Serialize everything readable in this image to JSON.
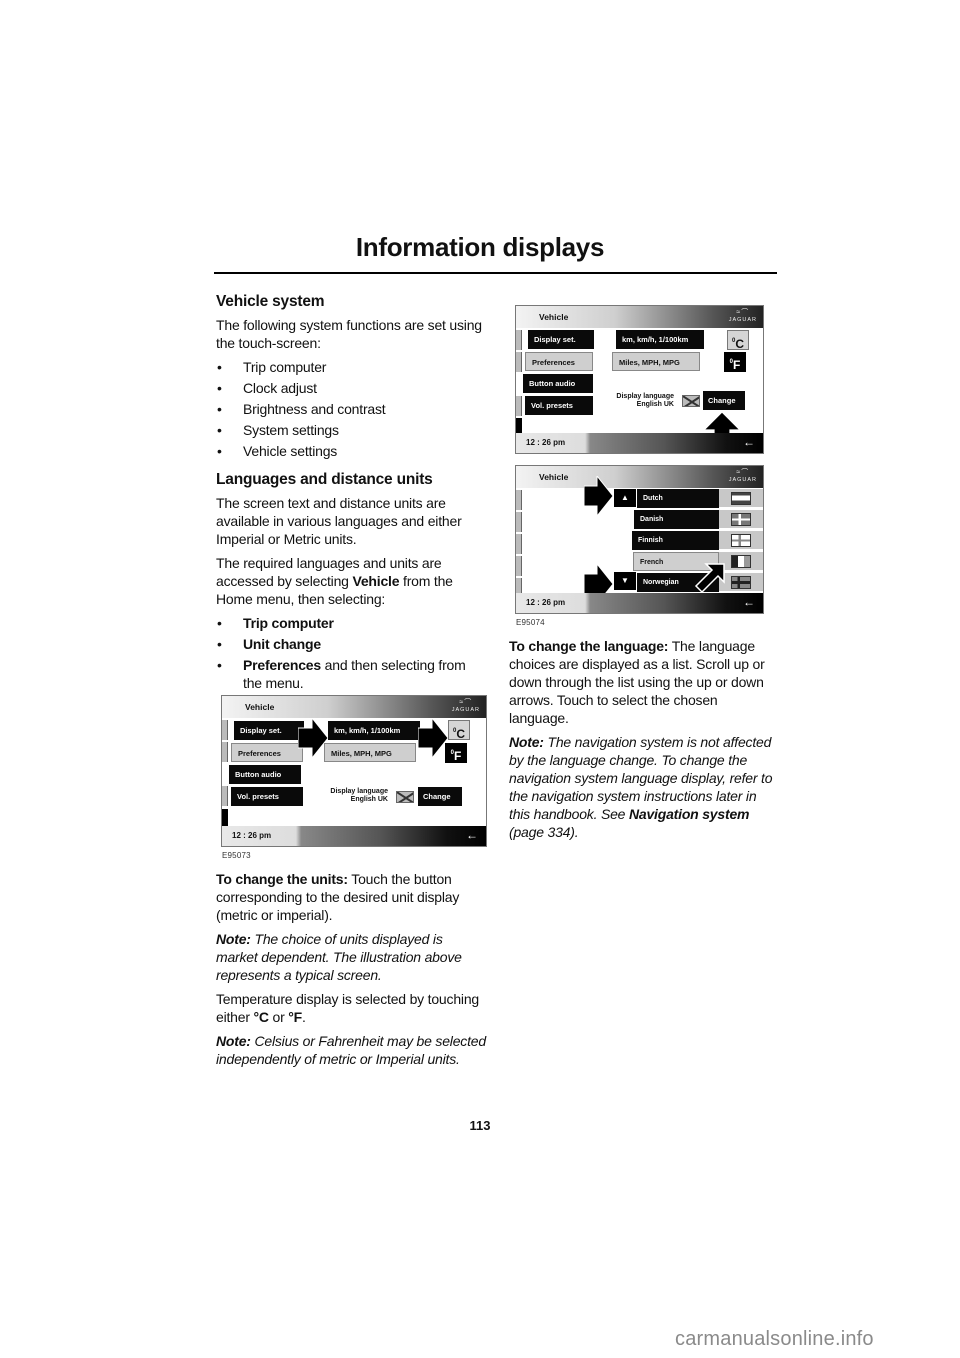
{
  "page": {
    "title": "Information displays",
    "page_number": "113",
    "watermark": "carmanualsonline.info"
  },
  "left": {
    "section1": {
      "heading": "Vehicle system",
      "intro": "The following system functions are set using the touch-screen:",
      "items": [
        "Trip computer",
        "Clock adjust",
        "Brightness and contrast",
        "System settings",
        "Vehicle settings"
      ]
    },
    "section2": {
      "heading": "Languages and distance units",
      "p1": "The screen text and distance units are available in various languages and either Imperial or Metric units.",
      "p2_pre": "The required languages and units are accessed by selecting ",
      "p2_bold": "Vehicle",
      "p2_post": " from the Home menu, then selecting:",
      "items": [
        {
          "bold": "Trip computer",
          "rest": ""
        },
        {
          "bold": "Unit change",
          "rest": ""
        },
        {
          "bold": "Preferences",
          "rest": " and then selecting from the menu."
        }
      ]
    },
    "units_para": {
      "bold": "To change the units:",
      "rest": " Touch the button corresponding to the desired unit display (metric or imperial)."
    },
    "note1": {
      "bold": "Note:",
      "rest": " The choice of units displayed is market dependent. The illustration above represents a typical screen."
    },
    "temp_para": {
      "pre": "Temperature display is selected by touching either ",
      "c": "°C",
      "mid": " or ",
      "f": "°F",
      "post": "."
    },
    "note2": {
      "bold": "Note:",
      "rest": " Celsius or Fahrenheit may be selected independently of metric or Imperial units."
    }
  },
  "right": {
    "lang_para": {
      "bold": "To change the language:",
      "rest": " The language choices are displayed as a list. Scroll up or down through the list using the up or down arrows. Touch to select the chosen language."
    },
    "note3": {
      "bold": "Note:",
      "rest": " The navigation system is not affected by the language change. To change the navigation system language display, refer to the navigation system instructions later in this handbook. See ",
      "link": "Navigation system",
      "tail": " (page 334)."
    }
  },
  "screen": {
    "header": "Vehicle",
    "brand": "JAGUAR",
    "time": "12 : 26 pm",
    "back": "←",
    "menu": [
      "Display set.",
      "Preferences",
      "Button audio",
      "Vol. presets"
    ],
    "metric": "km,  km/h,  1/100km",
    "imperial": "Miles,  MPH,  MPG",
    "celsius": "C",
    "fahrenheit": "F",
    "degree": "0",
    "display_language_label": "Display language",
    "display_language_value": "English UK",
    "change": "Change",
    "languages": [
      "Dutch",
      "Danish",
      "Finnish",
      "French",
      "Norwegian"
    ]
  },
  "figures": {
    "fig1_id": "E95073",
    "fig3_id": "E95074"
  },
  "icons": {
    "arrow_up": "▲",
    "arrow_down": "▼"
  }
}
